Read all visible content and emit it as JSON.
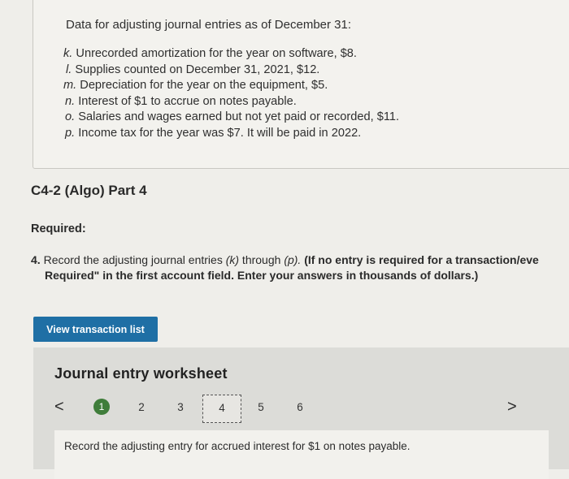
{
  "data_box": {
    "title": "Data for adjusting journal entries as of December 31:",
    "items": [
      {
        "letter": "k.",
        "text": "Unrecorded amortization for the year on software, $8."
      },
      {
        "letter": "l.",
        "text": "Supplies counted on December 31, 2021, $12."
      },
      {
        "letter": "m.",
        "text": "Depreciation for the year on the equipment, $5."
      },
      {
        "letter": "n.",
        "text": "Interest of $1 to accrue on notes payable."
      },
      {
        "letter": "o.",
        "text": "Salaries and wages earned but not yet paid or recorded, $11."
      },
      {
        "letter": "p.",
        "text": "Income tax for the year was $7. It will be paid in 2022."
      }
    ]
  },
  "section_title": "C4-2 (Algo) Part 4",
  "required_label": "Required:",
  "instruction": {
    "number": "4.",
    "text_start": "Record the adjusting journal entries ",
    "k": "(k)",
    "through": " through ",
    "p": "(p).",
    "bold_start": " (If no entry is required for a transaction/eve",
    "bold_line2": "Required\" in the first account field. Enter your answers in thousands of dollars.)"
  },
  "view_button": "View transaction list",
  "worksheet": {
    "title": "Journal entry worksheet",
    "pages": [
      "1",
      "2",
      "3",
      "4",
      "5",
      "6"
    ],
    "current_page": "4",
    "prev_arrow": "<",
    "next_arrow": ">",
    "entry_instruction": "Record the adjusting entry for accrued interest for $1 on notes payable."
  },
  "colors": {
    "button": "#1f6fa5",
    "done_badge": "#3f7d3a"
  }
}
